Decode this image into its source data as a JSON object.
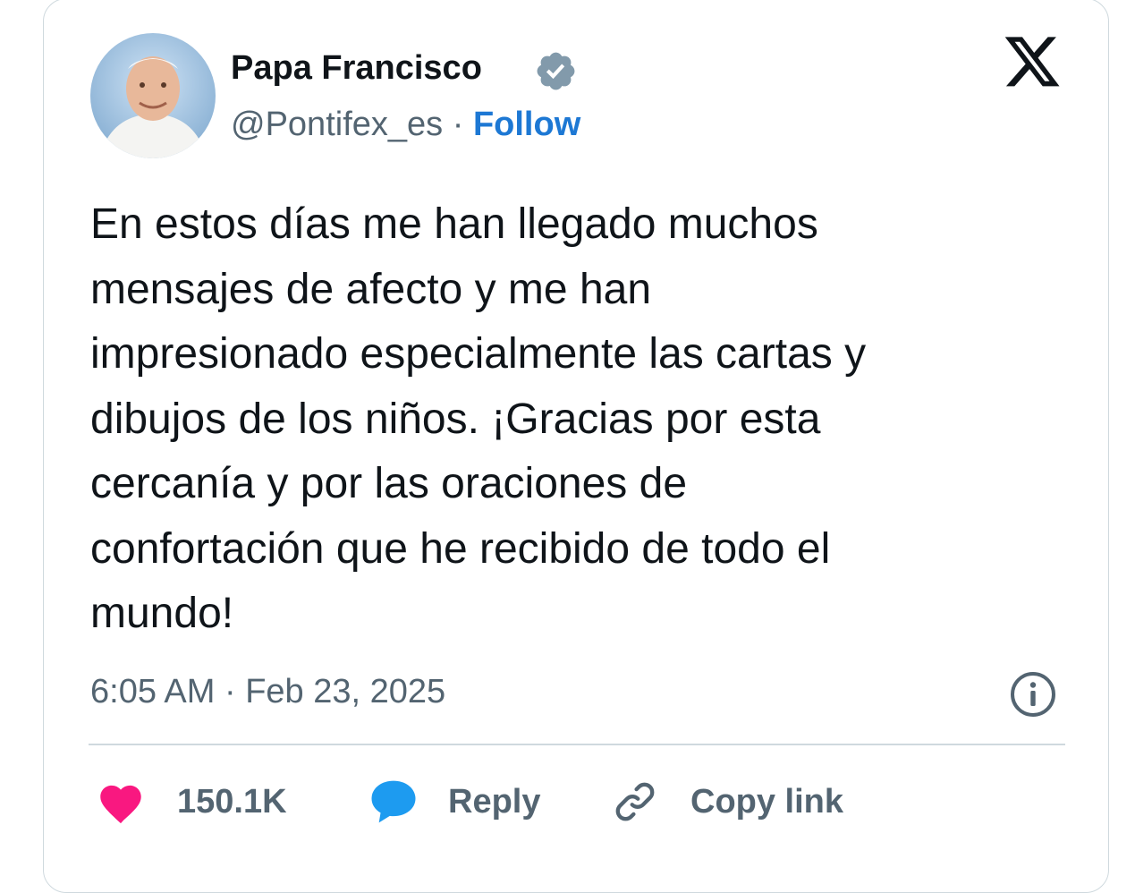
{
  "author": {
    "name": "Papa Francisco",
    "handle": "@Pontifex_es",
    "separator": " · ",
    "follow_label": "Follow"
  },
  "tweet": {
    "text": "En estos días me han llegado muchos\nmensajes de afecto y me han\nimpresionado especialmente las cartas y\ndibujos de los niños. ¡Gracias por esta\ncercanía y por las oraciones de\nconfortación que he recibido de todo el\nmundo!",
    "timestamp": "6:05 AM · Feb 23, 2025"
  },
  "actions": {
    "like_count": "150.1K",
    "reply_label": "Reply",
    "copy_label": "Copy link"
  },
  "icons": {
    "verified": "verified-badge-icon",
    "x_logo": "x-logo-icon",
    "info": "info-icon",
    "heart": "heart-icon",
    "reply": "speech-bubble-icon",
    "link": "link-icon"
  },
  "colors": {
    "heart": "#f91880",
    "reply_bubble": "#1d9bf0",
    "follow": "#1d78d4",
    "verified": "#829aab",
    "text": "#0f1419",
    "muted": "#536471"
  }
}
